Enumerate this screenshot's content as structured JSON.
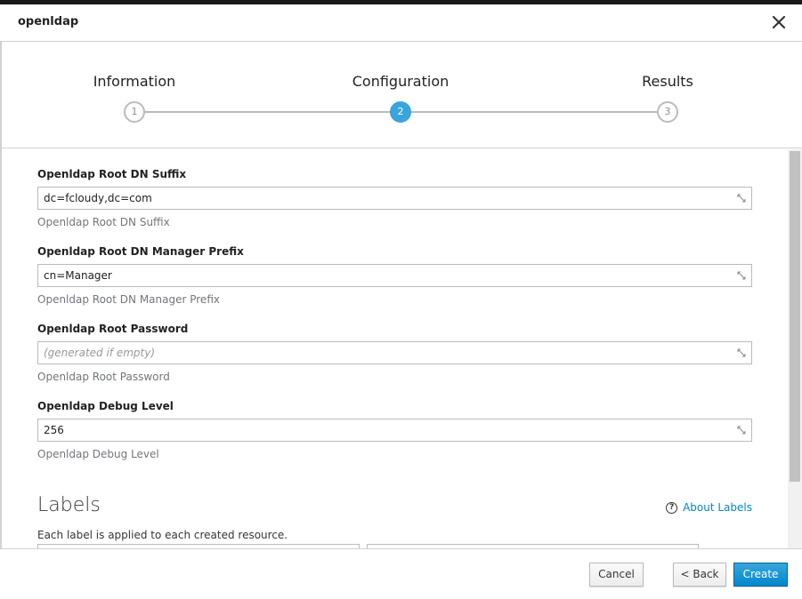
{
  "header": {
    "title": "openldap"
  },
  "steps": [
    {
      "label": "Information",
      "number": "1",
      "state": "inactive"
    },
    {
      "label": "Configuration",
      "number": "2",
      "state": "active"
    },
    {
      "label": "Results",
      "number": "3",
      "state": "inactive"
    }
  ],
  "fields": [
    {
      "label": "Openldap Root DN Suffix",
      "value": "dc=fcloudy,dc=com",
      "placeholder": "",
      "help": "Openldap Root DN Suffix"
    },
    {
      "label": "Openldap Root DN Manager Prefix",
      "value": "cn=Manager",
      "placeholder": "",
      "help": "Openldap Root DN Manager Prefix"
    },
    {
      "label": "Openldap Root Password",
      "value": "",
      "placeholder": "(generated if empty)",
      "help": "Openldap Root Password"
    },
    {
      "label": "Openldap Debug Level",
      "value": "256",
      "placeholder": "",
      "help": "Openldap Debug Level"
    }
  ],
  "labels_section": {
    "title": "Labels",
    "about_link": "About Labels",
    "help": "Each label is applied to each created resource."
  },
  "footer": {
    "cancel_label": "Cancel",
    "back_label": "< Back",
    "create_label": "Create"
  },
  "colors": {
    "accent": "#39a5dc",
    "primary_button": "#0088ce",
    "link": "#0088ce"
  },
  "icons": {
    "close": "close-icon",
    "resize": "resize-icon",
    "help": "question-circle-icon"
  }
}
